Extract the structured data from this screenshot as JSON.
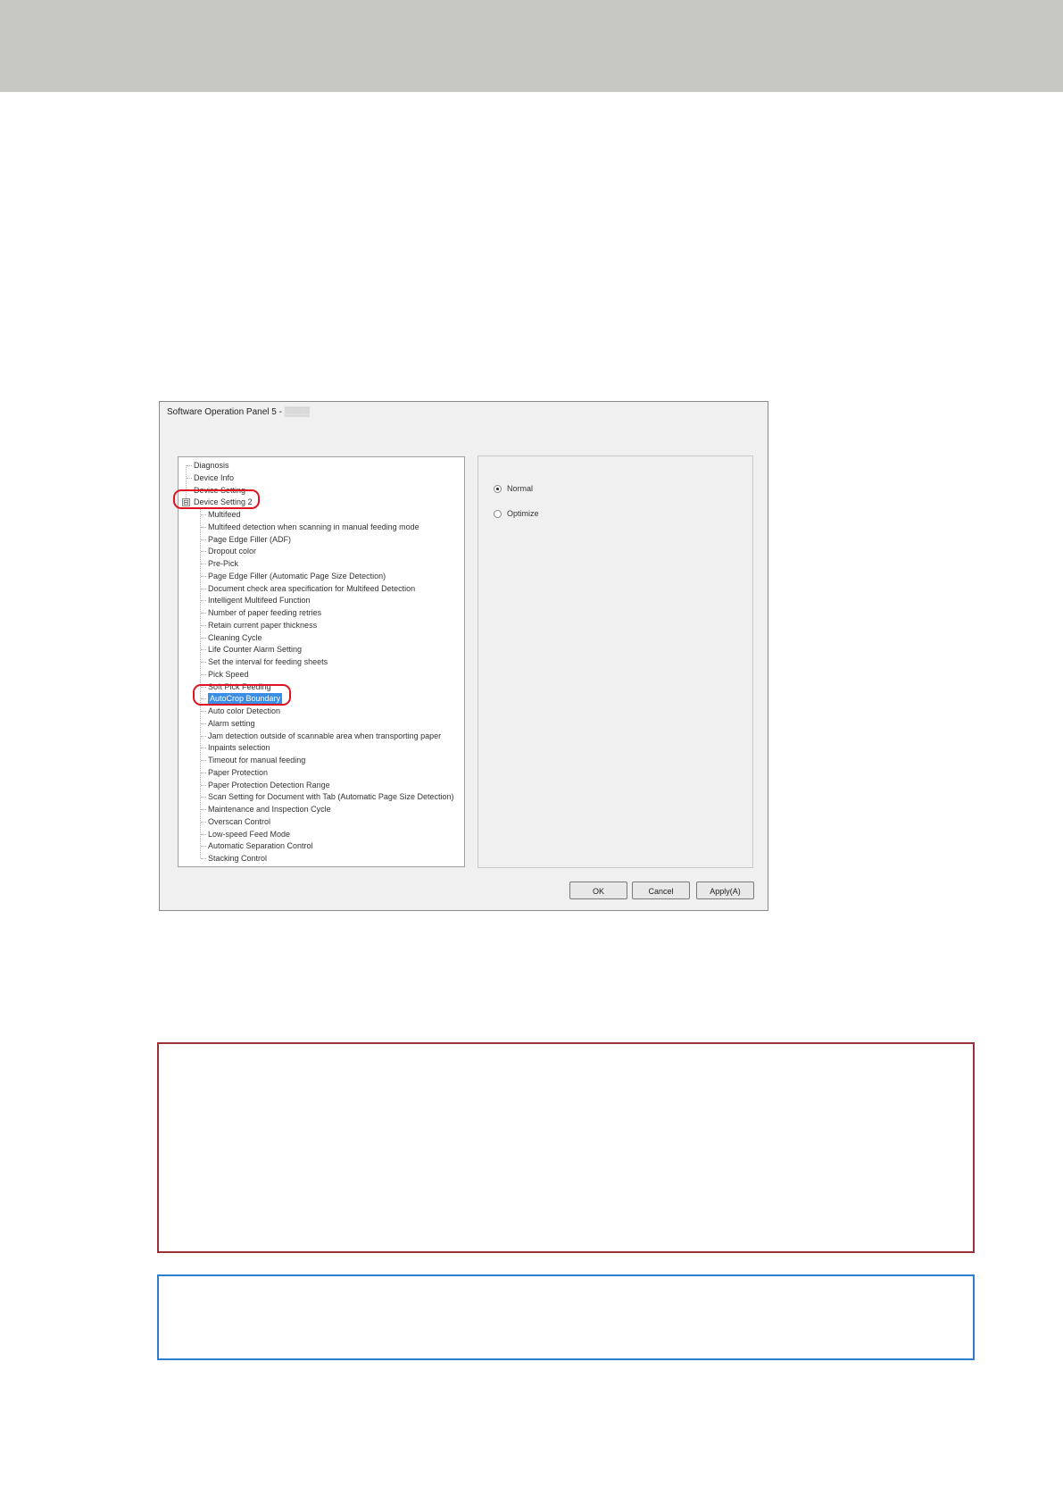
{
  "dialog": {
    "title": "Software Operation Panel 5 - ",
    "title_blurred_suffix": "▒▒▒▒",
    "tree": [
      {
        "label": "Diagnosis",
        "level": 0
      },
      {
        "label": "Device Info",
        "level": 0
      },
      {
        "label": "Device Setting",
        "level": 0
      },
      {
        "label": "Device Setting 2",
        "level": 0,
        "expander": "⊟"
      },
      {
        "label": "Multifeed",
        "level": 1
      },
      {
        "label": "Multifeed detection when scanning in manual feeding mode",
        "level": 1
      },
      {
        "label": "Page Edge Filler (ADF)",
        "level": 1
      },
      {
        "label": "Dropout color",
        "level": 1
      },
      {
        "label": "Pre-Pick",
        "level": 1
      },
      {
        "label": "Page Edge Filler (Automatic Page Size Detection)",
        "level": 1
      },
      {
        "label": "Document check area specification for Multifeed Detection",
        "level": 1
      },
      {
        "label": "Intelligent Multifeed Function",
        "level": 1
      },
      {
        "label": "Number of paper feeding retries",
        "level": 1
      },
      {
        "label": "Retain current paper thickness",
        "level": 1
      },
      {
        "label": "Cleaning Cycle",
        "level": 1
      },
      {
        "label": "Life Counter Alarm Setting",
        "level": 1
      },
      {
        "label": "Set the interval for feeding sheets",
        "level": 1
      },
      {
        "label": "Pick Speed",
        "level": 1
      },
      {
        "label": "Soft Pick Feeding",
        "level": 1
      },
      {
        "label": "AutoCrop Boundary",
        "level": 1,
        "selected": true
      },
      {
        "label": "Auto color Detection",
        "level": 1
      },
      {
        "label": "Alarm setting",
        "level": 1
      },
      {
        "label": "Jam detection outside of scannable area when transporting paper",
        "level": 1
      },
      {
        "label": "Inpaints selection",
        "level": 1
      },
      {
        "label": "Timeout for manual feeding",
        "level": 1
      },
      {
        "label": "Paper Protection",
        "level": 1
      },
      {
        "label": "Paper Protection Detection Range",
        "level": 1
      },
      {
        "label": "Scan Setting for Document with Tab (Automatic Page Size Detection)",
        "level": 1
      },
      {
        "label": "Maintenance and Inspection Cycle",
        "level": 1
      },
      {
        "label": "Overscan Control",
        "level": 1
      },
      {
        "label": "Low-speed Feed Mode",
        "level": 1
      },
      {
        "label": "Automatic Separation Control",
        "level": 1
      },
      {
        "label": "Stacking Control",
        "level": 1
      }
    ],
    "options": [
      {
        "label": "Normal",
        "checked": true
      },
      {
        "label": "Optimize",
        "checked": false
      }
    ],
    "buttons": {
      "ok": "OK",
      "cancel": "Cancel",
      "apply": "Apply(A)"
    }
  },
  "colors": {
    "top_band": "#c8c8c2",
    "highlight": "#e0141e",
    "attention_border": "#9b3135",
    "hint_border": "#2f7fd1",
    "selection": "#3a8ee6"
  }
}
